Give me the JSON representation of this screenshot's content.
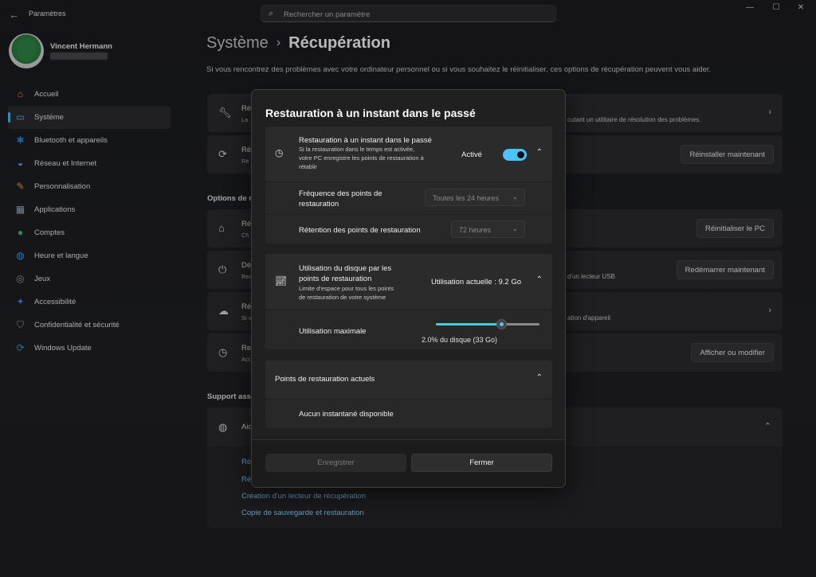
{
  "window": {
    "title": "Paramètres",
    "search_placeholder": "Rechercher un paramètre",
    "minimize_icon": "—",
    "maximize_icon": "☐",
    "close_icon": "✕"
  },
  "user": {
    "name": "Vincent Hermann"
  },
  "sidebar": {
    "items": [
      {
        "label": "Accueil",
        "icon": "home-icon",
        "glyph": "⌂",
        "color": "#ff8a50"
      },
      {
        "label": "Système",
        "icon": "system-icon",
        "glyph": "▭",
        "color": "#4cc2ff"
      },
      {
        "label": "Bluetooth et appareils",
        "icon": "bluetooth-icon",
        "glyph": "✱",
        "color": "#2f8be6"
      },
      {
        "label": "Réseau et Internet",
        "icon": "wifi-icon",
        "glyph": "◒",
        "color": "#6fb4ff"
      },
      {
        "label": "Personnalisation",
        "icon": "brush-icon",
        "glyph": "✎",
        "color": "#f0a25a"
      },
      {
        "label": "Applications",
        "icon": "apps-icon",
        "glyph": "▦",
        "color": "#a7b4c6"
      },
      {
        "label": "Comptes",
        "icon": "account-icon",
        "glyph": "●",
        "color": "#3fc28a"
      },
      {
        "label": "Heure et langue",
        "icon": "globe-clock-icon",
        "glyph": "◍",
        "color": "#3aa0e8"
      },
      {
        "label": "Jeux",
        "icon": "gamepad-icon",
        "glyph": "◎",
        "color": "#a0a0a8"
      },
      {
        "label": "Accessibilité",
        "icon": "accessibility-icon",
        "glyph": "✦",
        "color": "#3a8ee8"
      },
      {
        "label": "Confidentialité et sécurité",
        "icon": "shield-icon",
        "glyph": "⛉",
        "color": "#9a9aa6"
      },
      {
        "label": "Windows Update",
        "icon": "update-icon",
        "glyph": "⟳",
        "color": "#3a9ae8"
      }
    ],
    "active_index": 1
  },
  "main": {
    "breadcrumb_parent": "Système",
    "breadcrumb_sep": "›",
    "breadcrumb_current": "Récupération",
    "intro": "Si vous rencontrez des problèmes avec votre ordinateur personnel ou si vous souhaitez le réinitialiser, ces options de récupération peuvent vous aider.",
    "card1": {
      "title": "Ré",
      "sub": "La",
      "right": "cutant un utilitaire de résolution des problèmes."
    },
    "card2": {
      "title": "Ré",
      "sub": "Ré",
      "button": "Réinstaller maintenant"
    },
    "section_options": "Options de r",
    "card3": {
      "title": "Ré",
      "sub": "Ch",
      "button": "Réinitialiser le PC"
    },
    "card4": {
      "title": "Dé",
      "sub": "Red",
      "right": "d'un lecteur USB",
      "button": "Redémarrer maintenant"
    },
    "card5": {
      "title": "Ré",
      "sub": "Si v",
      "right": "ation d'appareil"
    },
    "card6": {
      "title": "Res",
      "sub": "Act",
      "button": "Afficher ou modifier"
    },
    "section_support": "Support ass",
    "card7": {
      "title": "Aid"
    },
    "links": [
      "Ré",
      "Ré",
      "Création d'un lecteur de récupération",
      "Copie de sauvegarde et restauration"
    ]
  },
  "dialog": {
    "title": "Restauration à un instant dans le passé",
    "restore": {
      "title": "Restauration à un instant dans le passé",
      "sub1": "Si la restauration dans le temps est activée,",
      "sub2": "votre PC enregistre les points de restauration à",
      "sub3": "rétablir",
      "state": "Activé",
      "enabled": true
    },
    "frequency": {
      "label1": "Fréquence des points de",
      "label2": "restauration",
      "value": "Toutes les 24 heures"
    },
    "retention": {
      "label": "Rétention des points de restauration",
      "value": "72 heures"
    },
    "disk": {
      "title1": "Utilisation du disque par les",
      "title2": "points de restauration",
      "sub1": "Limite d'espace pour tous les points",
      "sub2": "de restauration de votre système",
      "current": "Utilisation actuelle : 9.2 Go",
      "max_label": "Utilisation maximale",
      "max_value": "2.0% du disque (33 Go)",
      "slider_fraction": 0.63
    },
    "points": {
      "title": "Points de restauration actuels",
      "empty": "Aucun instantané disponible"
    },
    "save_button": "Enregistrer",
    "close_button": "Fermer"
  }
}
